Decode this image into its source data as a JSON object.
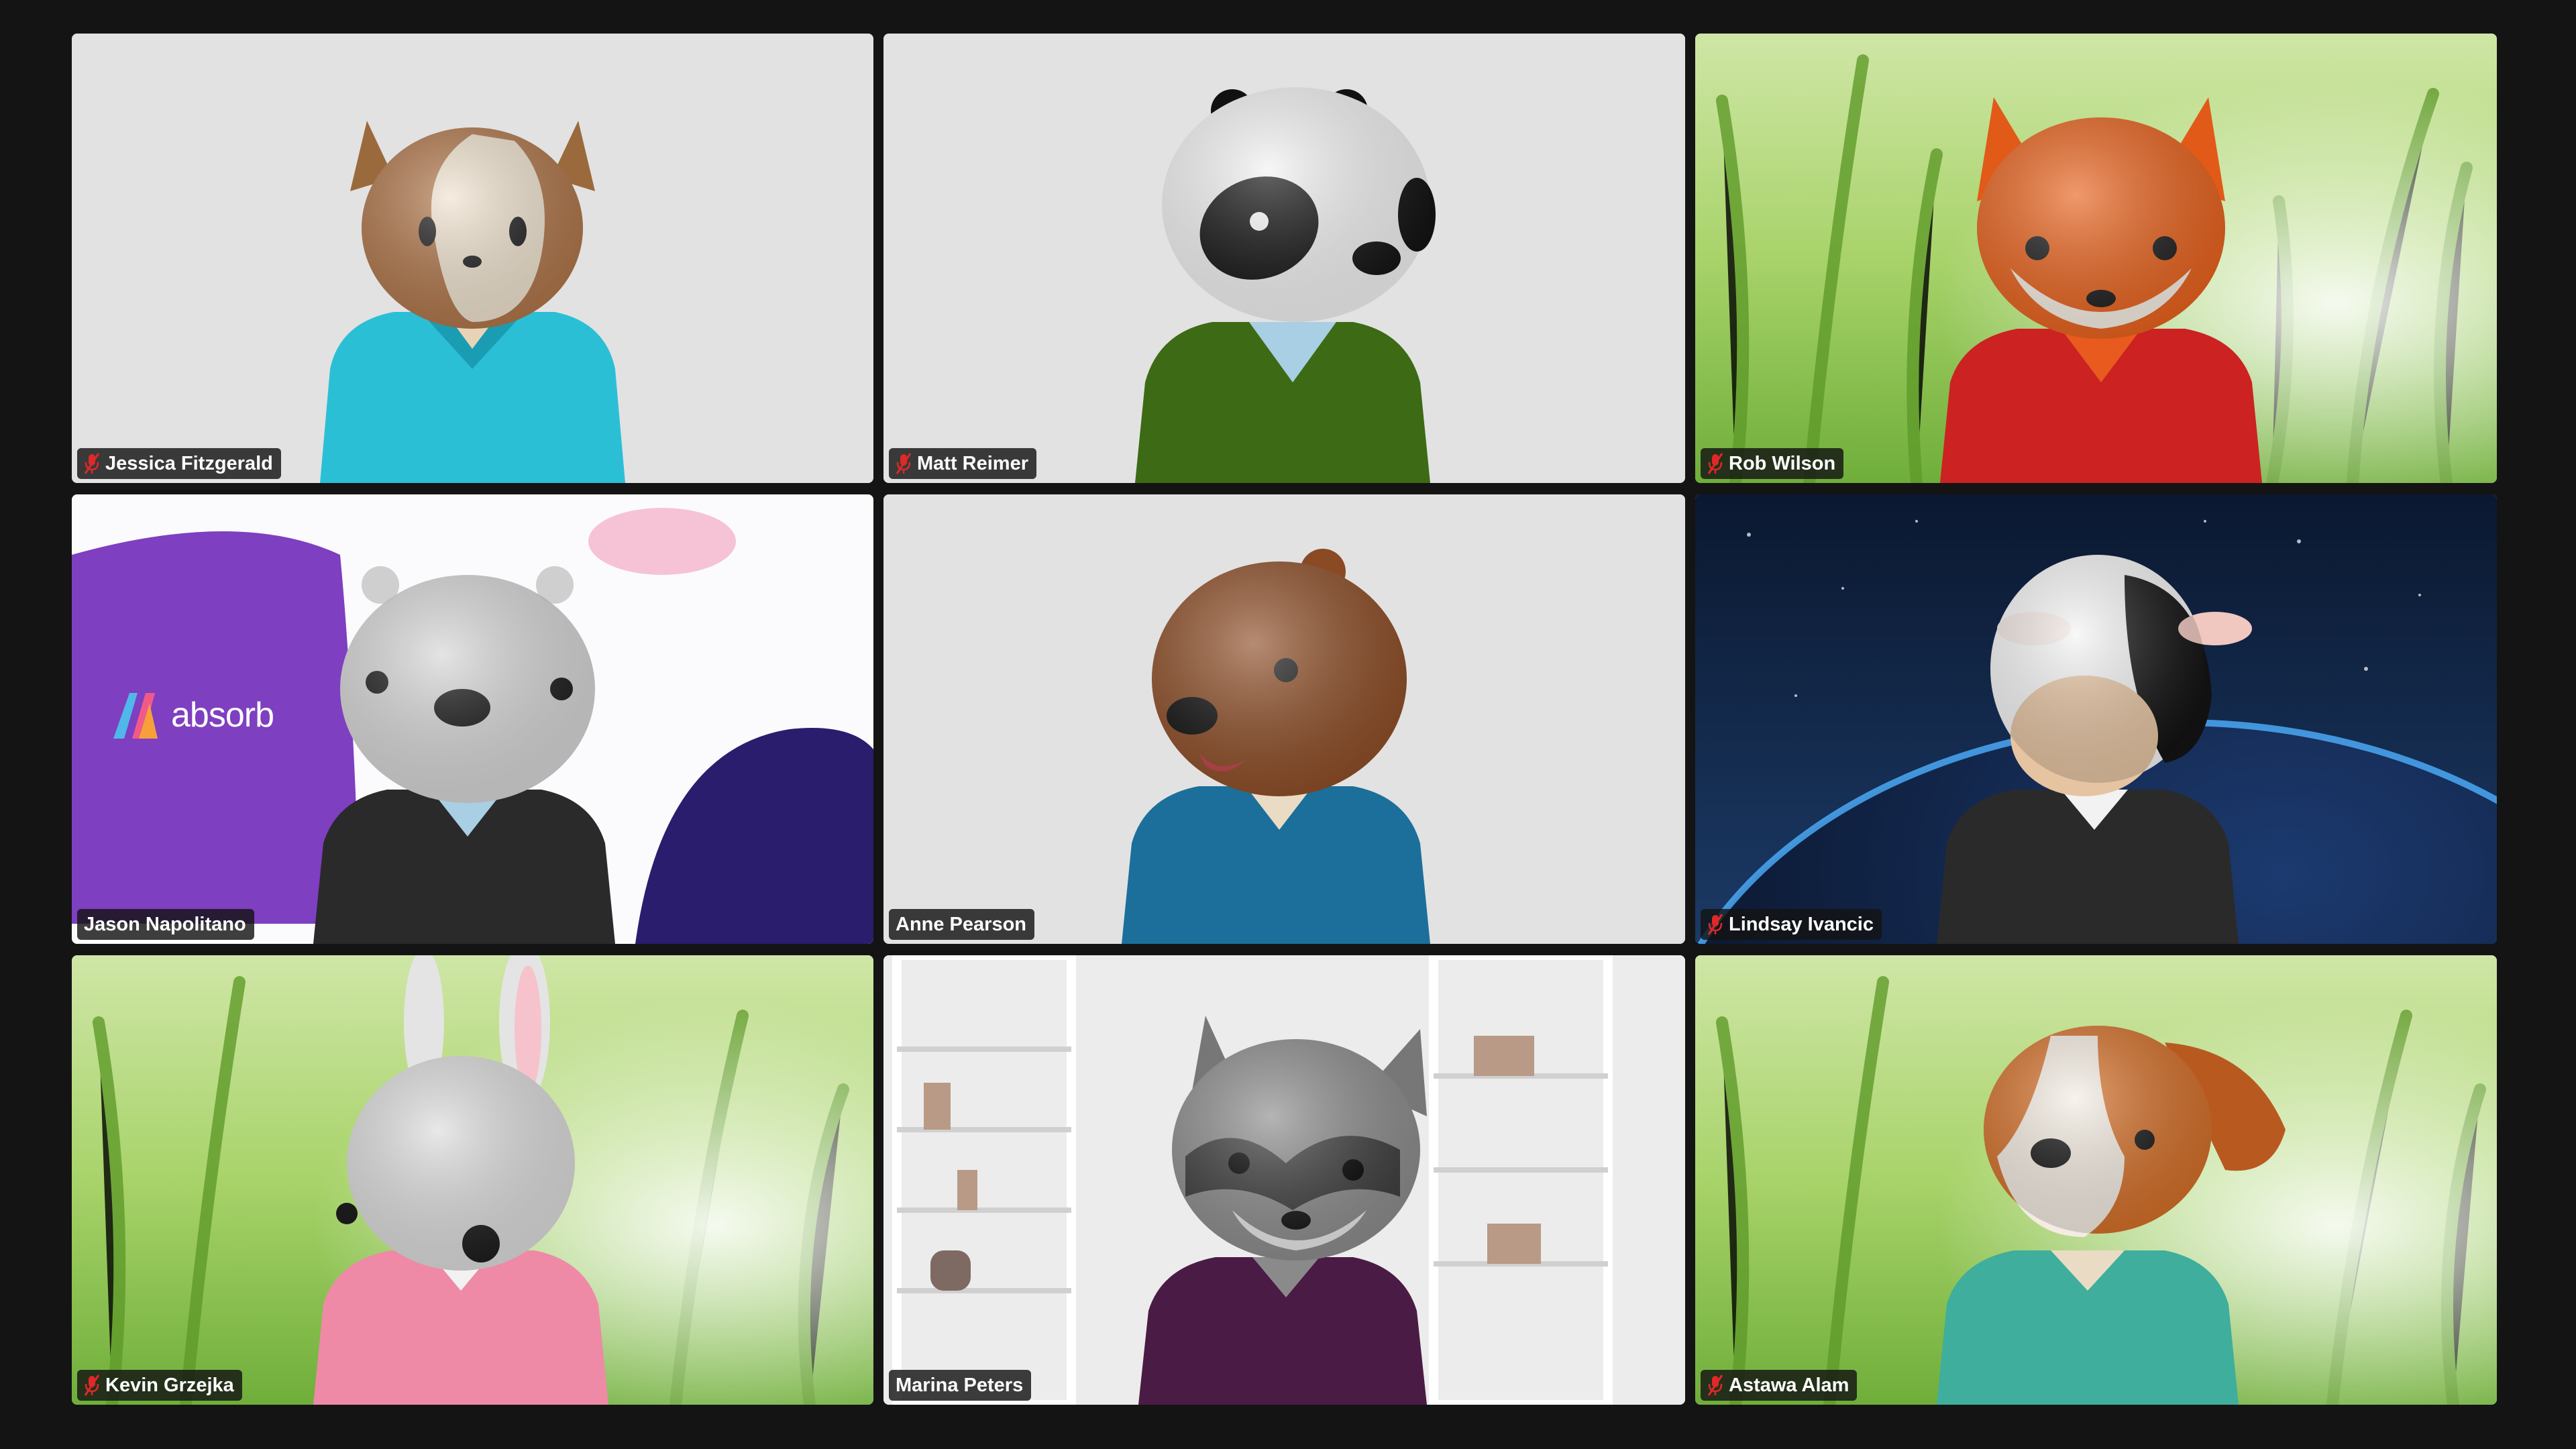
{
  "participants": [
    {
      "name": "Jessica Fitzgerald",
      "muted": true,
      "avatar": "cat",
      "hoodie": "#2bbfd6",
      "background": "plain-gray"
    },
    {
      "name": "Matt Reimer",
      "muted": true,
      "avatar": "panda",
      "hoodie": "#3d6a14",
      "background": "plain-gray"
    },
    {
      "name": "Rob Wilson",
      "muted": true,
      "avatar": "fox",
      "hoodie": "#cc2222",
      "background": "grass"
    },
    {
      "name": "Jason Napolitano",
      "muted": false,
      "avatar": "otter",
      "hoodie": "#2a2a2a",
      "background": "absorb-brand"
    },
    {
      "name": "Anne Pearson",
      "muted": false,
      "avatar": "bear",
      "hoodie": "#1c6f9a",
      "background": "plain-gray",
      "active_speaker": true
    },
    {
      "name": "Lindsay Ivancic",
      "muted": true,
      "avatar": "cow",
      "hoodie": "#2a2a2a",
      "background": "space-earth"
    },
    {
      "name": "Kevin Grzejka",
      "muted": true,
      "avatar": "rabbit",
      "hoodie": "#ee8aa6",
      "background": "grass"
    },
    {
      "name": "Marina Peters",
      "muted": false,
      "avatar": "raccoon",
      "hoodie": "#4a1b45",
      "background": "bookshelf"
    },
    {
      "name": "Astawa Alam",
      "muted": true,
      "avatar": "dog",
      "hoodie": "#3fae9c",
      "background": "grass"
    }
  ],
  "brand": {
    "text": "absorb"
  },
  "colors": {
    "speaking_border": "#2fb24b",
    "muted_icon": "#e02828",
    "window_bg": "#141414"
  }
}
